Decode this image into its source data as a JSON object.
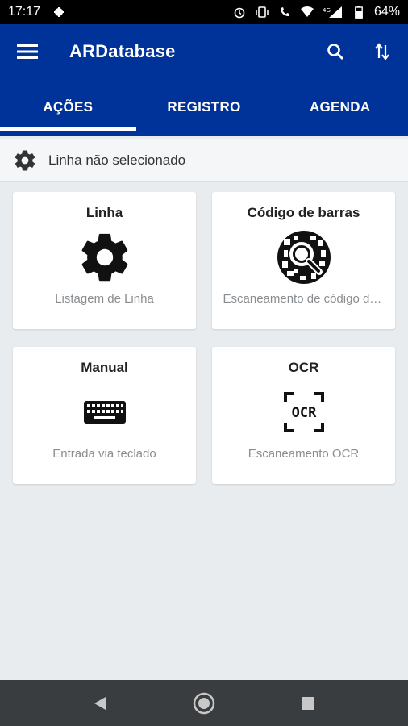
{
  "status_bar": {
    "time": "17:17",
    "signal_text": "4G",
    "battery": "64%"
  },
  "appbar": {
    "title": "ARDatabase",
    "color": "#003399"
  },
  "tabs": [
    {
      "label": "AÇÕES",
      "active": true
    },
    {
      "label": "REGISTRO",
      "active": false
    },
    {
      "label": "AGENDA",
      "active": false
    }
  ],
  "line_bar": {
    "label": "Linha não selecionado"
  },
  "cards": [
    {
      "title": "Linha",
      "subtitle": "Listagem de Linha",
      "icon": "gear-icon"
    },
    {
      "title": "Código de barras",
      "subtitle": "Escaneamento de código de barras",
      "icon": "barcode-scan-icon"
    },
    {
      "title": "Manual",
      "subtitle": "Entrada via teclado",
      "icon": "keyboard-icon"
    },
    {
      "title": "OCR",
      "subtitle": "Escaneamento OCR",
      "icon": "ocr-icon"
    }
  ]
}
